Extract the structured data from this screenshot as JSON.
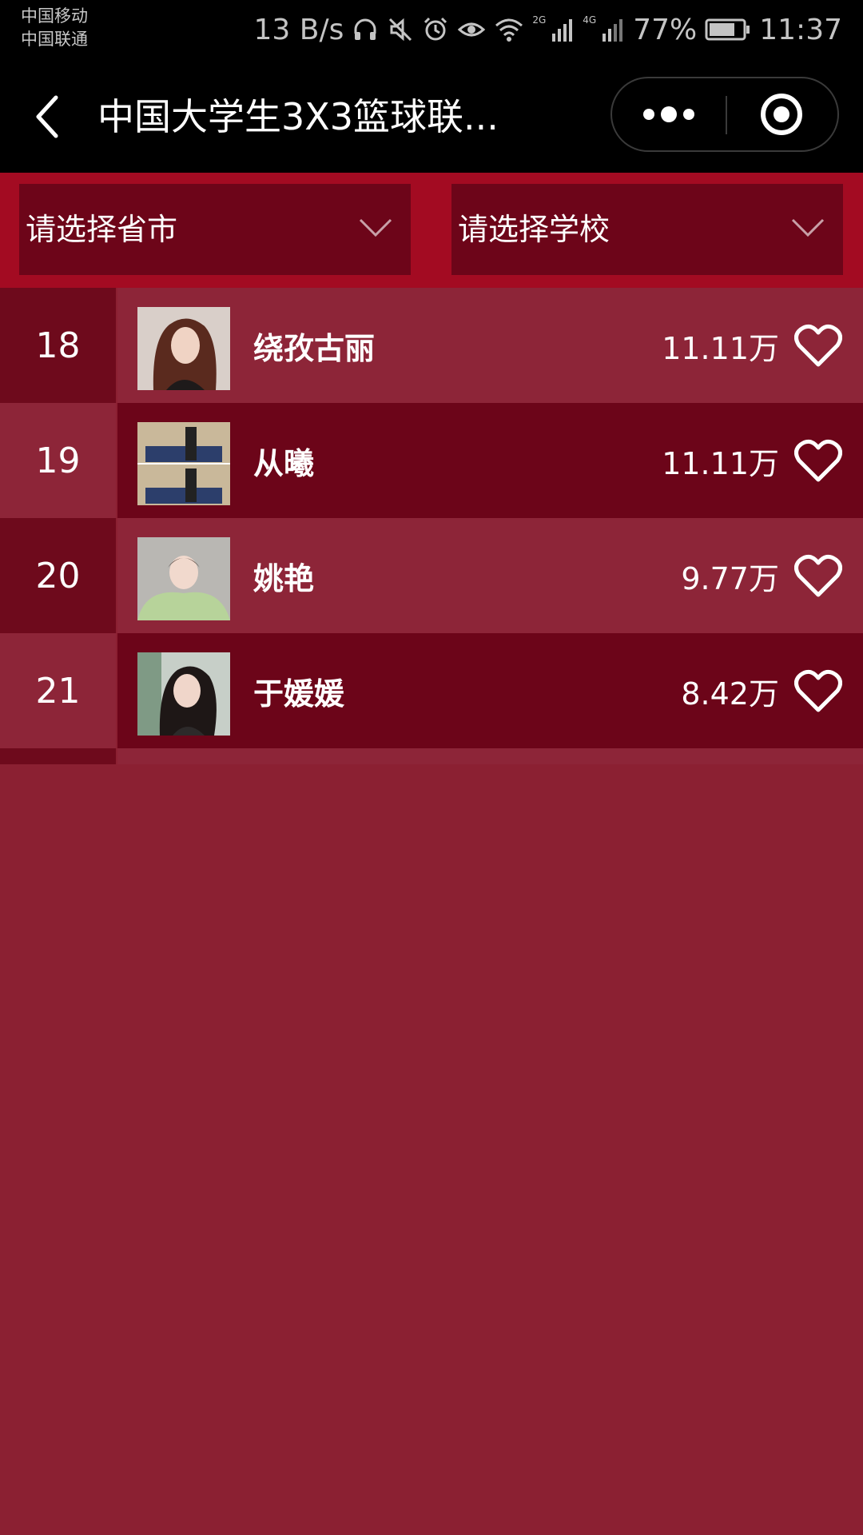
{
  "status_bar": {
    "carrier_1": "中国移动",
    "carrier_2": "中国联通",
    "net_speed": "13 B/s",
    "sim2_tag": "2G",
    "sim1_tag": "4G",
    "battery": "77%",
    "time": "11:37"
  },
  "nav": {
    "title": "中国大学生3X3篮球联..."
  },
  "filters": {
    "province_placeholder": "请选择省市",
    "school_placeholder": "请选择学校"
  },
  "ranking": [
    {
      "rank": "18",
      "name": "绕孜古丽",
      "votes": "11.11万"
    },
    {
      "rank": "19",
      "name": "从曦",
      "votes": "11.11万"
    },
    {
      "rank": "20",
      "name": "姚艳",
      "votes": "9.77万"
    },
    {
      "rank": "21",
      "name": "于媛媛",
      "votes": "8.42万"
    }
  ],
  "colors": {
    "page_background": "#8b2032",
    "filter_bar": "#a30b22",
    "select_box": "#6d0519",
    "row_light": "#8d2538",
    "row_dark": "#6c0519"
  }
}
